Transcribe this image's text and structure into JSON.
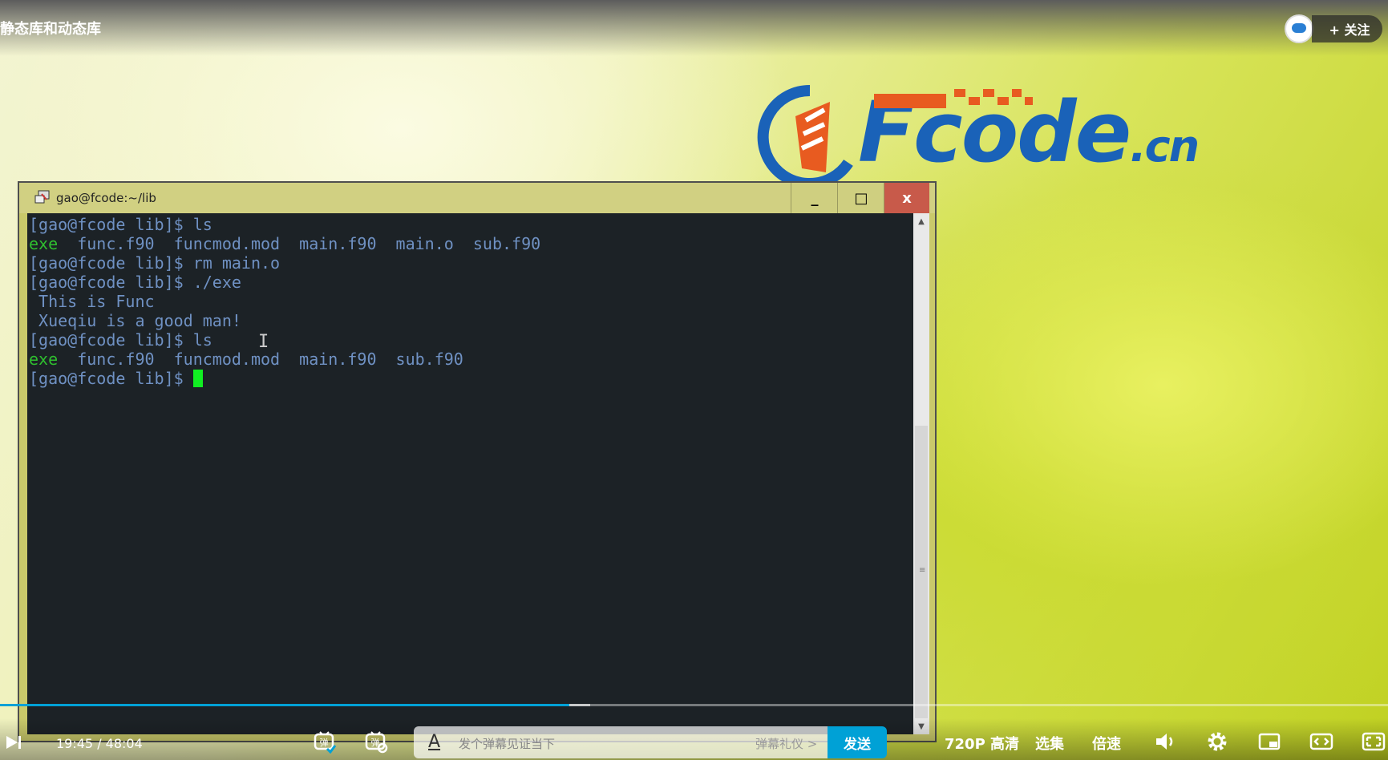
{
  "video": {
    "title": "静态库和动态库",
    "follow_label": "+ 关注"
  },
  "logo": {
    "main": "Fcode",
    "suffix": ".cn"
  },
  "putty": {
    "window_title": "gao@fcode:~/lib",
    "min_symbol": "_",
    "max_symbol": "□",
    "close_symbol": "x",
    "prompt": "[gao@fcode lib]$ ",
    "lines": [
      {
        "kind": "cmd",
        "text": "[gao@fcode lib]$ ls"
      },
      {
        "kind": "ls",
        "exe": "exe",
        "rest": "  func.f90  funcmod.mod  main.f90  main.o  sub.f90"
      },
      {
        "kind": "cmd",
        "text": "[gao@fcode lib]$ rm main.o"
      },
      {
        "kind": "cmd",
        "text": "[gao@fcode lib]$ ./exe"
      },
      {
        "kind": "out",
        "text": " This is Func"
      },
      {
        "kind": "out",
        "text": " Xueqiu is a good man!"
      },
      {
        "kind": "cmd",
        "text": "[gao@fcode lib]$ ls"
      },
      {
        "kind": "ls",
        "exe": "exe",
        "rest": "  func.f90  funcmod.mod  main.f90  sub.f90"
      }
    ],
    "ibeam": "I"
  },
  "player": {
    "current_time": "19:45",
    "total_time": "48:04",
    "time_sep": " / ",
    "played_fraction": 0.41,
    "buffered_fraction": 0.425,
    "danmaku_placeholder": "发个弹幕见证当下",
    "danmaku_etiquette": "弹幕礼仪 >",
    "send_label": "发送",
    "quality_label": "720P 高清",
    "episodes_label": "选集",
    "speed_label": "倍速"
  }
}
